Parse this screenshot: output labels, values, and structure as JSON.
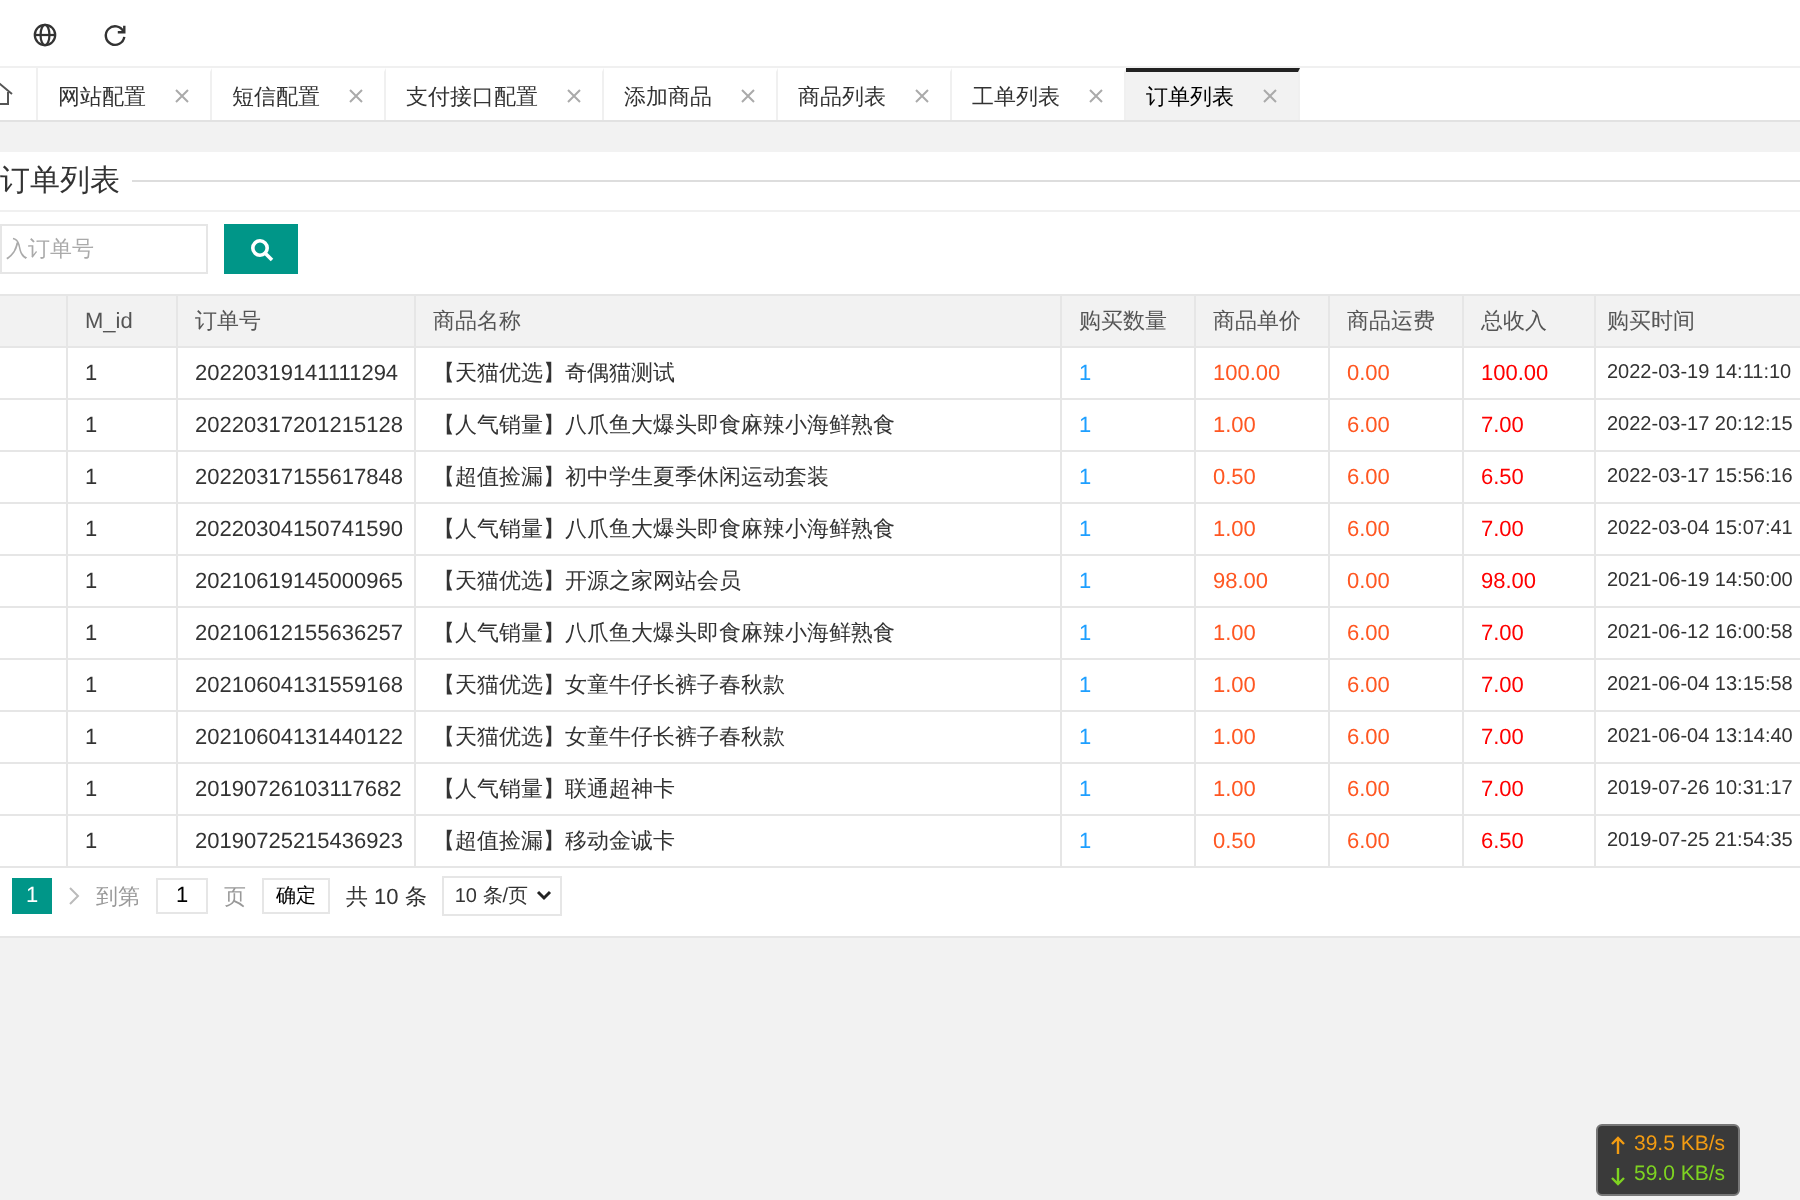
{
  "tabs": [
    {
      "label": "网站配置",
      "selected": false
    },
    {
      "label": "短信配置",
      "selected": false
    },
    {
      "label": "支付接口配置",
      "selected": false
    },
    {
      "label": "添加商品",
      "selected": false
    },
    {
      "label": "商品列表",
      "selected": false
    },
    {
      "label": "工单列表",
      "selected": false
    },
    {
      "label": "订单列表",
      "selected": true
    }
  ],
  "page_title": "订单列表",
  "search": {
    "placeholder": "入订单号"
  },
  "table": {
    "columns": [
      {
        "label": "M_id",
        "kind": "plain"
      },
      {
        "label": "订单号",
        "kind": "plain"
      },
      {
        "label": "商品名称",
        "kind": "plain"
      },
      {
        "label": "购买数量",
        "kind": "qty"
      },
      {
        "label": "商品单价",
        "kind": "price"
      },
      {
        "label": "商品运费",
        "kind": "price"
      },
      {
        "label": "总收入",
        "kind": "total"
      },
      {
        "label": "购买时间",
        "kind": "plain"
      }
    ],
    "rows": [
      [
        "1",
        "20220319141111294",
        "【天猫优选】奇偶猫测试",
        "1",
        "100.00",
        "0.00",
        "100.00",
        "2022-03-19 14:11:10"
      ],
      [
        "1",
        "20220317201215128",
        "【人气销量】八爪鱼大爆头即食麻辣小海鲜熟食",
        "1",
        "1.00",
        "6.00",
        "7.00",
        "2022-03-17 20:12:15"
      ],
      [
        "1",
        "20220317155617848",
        "【超值捡漏】初中学生夏季休闲运动套装",
        "1",
        "0.50",
        "6.00",
        "6.50",
        "2022-03-17 15:56:16"
      ],
      [
        "1",
        "20220304150741590",
        "【人气销量】八爪鱼大爆头即食麻辣小海鲜熟食",
        "1",
        "1.00",
        "6.00",
        "7.00",
        "2022-03-04 15:07:41"
      ],
      [
        "1",
        "20210619145000965",
        "【天猫优选】开源之家网站会员",
        "1",
        "98.00",
        "0.00",
        "98.00",
        "2021-06-19 14:50:00"
      ],
      [
        "1",
        "20210612155636257",
        "【人气销量】八爪鱼大爆头即食麻辣小海鲜熟食",
        "1",
        "1.00",
        "6.00",
        "7.00",
        "2021-06-12 16:00:58"
      ],
      [
        "1",
        "20210604131559168",
        "【天猫优选】女童牛仔长裤子春秋款",
        "1",
        "1.00",
        "6.00",
        "7.00",
        "2021-06-04 13:15:58"
      ],
      [
        "1",
        "20210604131440122",
        "【天猫优选】女童牛仔长裤子春秋款",
        "1",
        "1.00",
        "6.00",
        "7.00",
        "2021-06-04 13:14:40"
      ],
      [
        "1",
        "20190726103117682",
        "【人气销量】联通超神卡",
        "1",
        "1.00",
        "6.00",
        "7.00",
        "2019-07-26 10:31:17"
      ],
      [
        "1",
        "20190725215436923",
        "【超值捡漏】移动金诚卡",
        "1",
        "0.50",
        "6.00",
        "6.50",
        "2019-07-25 21:54:35"
      ]
    ]
  },
  "pagination": {
    "pages": [
      {
        "label": "1",
        "selected": true
      }
    ],
    "goto_label": "到第",
    "page_input": "1",
    "page_unit": "页",
    "confirm": "确定",
    "total": "共 10 条",
    "page_size": "10 条/页"
  },
  "net_speed": {
    "upload": "39.5 KB/s",
    "download": "59.0 KB/s"
  }
}
